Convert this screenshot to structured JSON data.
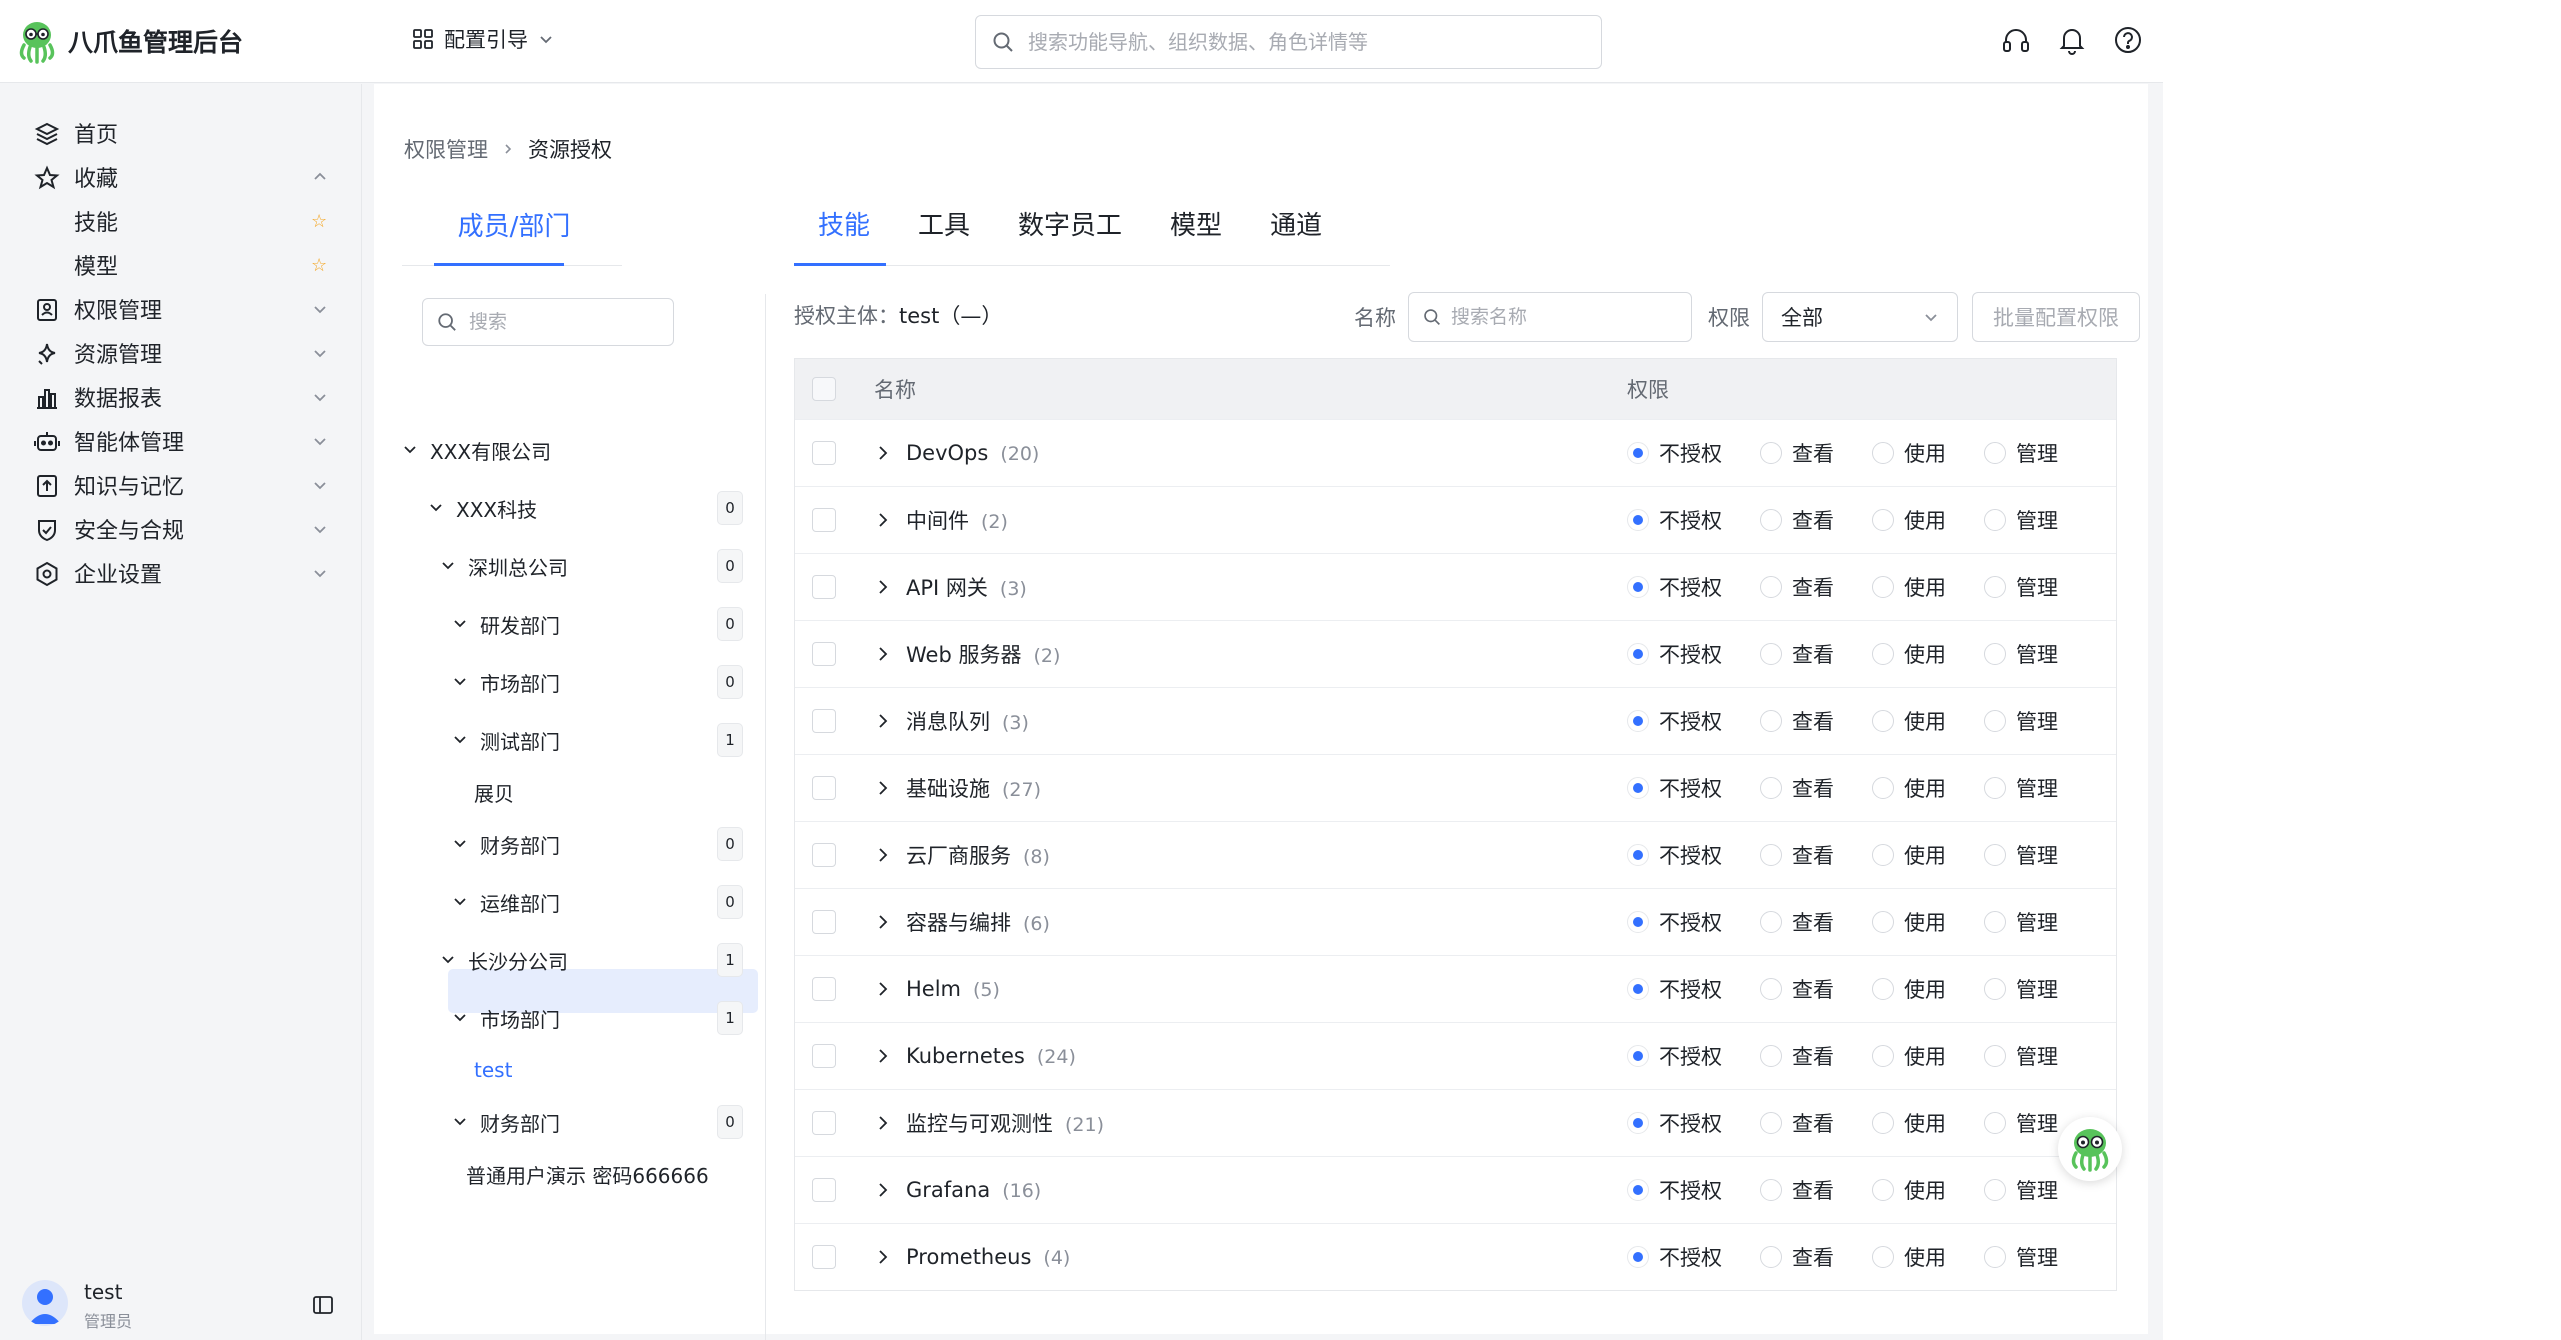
{
  "app": {
    "brand": "八爪鱼管理后台",
    "guide_label": "配置引导",
    "search_placeholder": "搜索功能导航、组织数据、角色详情等"
  },
  "sidebar": {
    "items": [
      {
        "label": "首页",
        "icon": "layers-icon"
      },
      {
        "label": "收藏",
        "icon": "star-icon"
      },
      {
        "label": "技能",
        "icon": "star-filled-icon"
      },
      {
        "label": "模型",
        "icon": "star-filled-icon"
      },
      {
        "label": "权限管理",
        "icon": "id-card-icon"
      },
      {
        "label": "资源管理",
        "icon": "sparkle-icon"
      },
      {
        "label": "数据报表",
        "icon": "bar-chart-icon"
      },
      {
        "label": "智能体管理",
        "icon": "robot-icon"
      },
      {
        "label": "知识与记忆",
        "icon": "book-upload-icon"
      },
      {
        "label": "安全与合规",
        "icon": "shield-check-icon"
      },
      {
        "label": "企业设置",
        "icon": "settings-hex-icon"
      }
    ],
    "user": {
      "name": "test",
      "role": "管理员"
    }
  },
  "breadcrumb": {
    "parent": "权限管理",
    "current": "资源授权"
  },
  "left_tab": "成员/部门",
  "tree": {
    "search_placeholder": "搜索",
    "nodes": [
      {
        "label": "XXX有限公司",
        "count": null
      },
      {
        "label": "XXX科技",
        "count": "0"
      },
      {
        "label": "深圳总公司",
        "count": "0"
      },
      {
        "label": "研发部门",
        "count": "0"
      },
      {
        "label": "市场部门",
        "count": "0"
      },
      {
        "label": "测试部门",
        "count": "1"
      },
      {
        "label": "展贝",
        "count": null
      },
      {
        "label": "财务部门",
        "count": "0"
      },
      {
        "label": "运维部门",
        "count": "0"
      },
      {
        "label": "长沙分公司",
        "count": "1"
      },
      {
        "label": "市场部门",
        "count": "1"
      },
      {
        "label": "test",
        "count": null
      },
      {
        "label": "财务部门",
        "count": "0"
      },
      {
        "label": "普通用户演示 密码666666",
        "count": null
      }
    ]
  },
  "tabs": [
    "技能",
    "工具",
    "数字员工",
    "模型",
    "通道"
  ],
  "subject": {
    "label": "授权主体：",
    "value": "test（—）"
  },
  "filters": {
    "name_label": "名称",
    "name_placeholder": "搜索名称",
    "perm_label": "权限",
    "perm_value": "全部",
    "batch_button": "批量配置权限"
  },
  "table": {
    "col_name": "名称",
    "col_perm": "权限",
    "perm_options": [
      "不授权",
      "查看",
      "使用",
      "管理"
    ],
    "rows": [
      {
        "name": "DevOps",
        "count": "(20)",
        "selected": "不授权"
      },
      {
        "name": "中间件",
        "count": "(2)",
        "selected": "不授权"
      },
      {
        "name": "API 网关",
        "count": "(3)",
        "selected": "不授权"
      },
      {
        "name": "Web 服务器",
        "count": "(2)",
        "selected": "不授权"
      },
      {
        "name": "消息队列",
        "count": "(3)",
        "selected": "不授权"
      },
      {
        "name": "基础设施",
        "count": "(27)",
        "selected": "不授权"
      },
      {
        "name": "云厂商服务",
        "count": "(8)",
        "selected": "不授权"
      },
      {
        "name": "容器与编排",
        "count": "(6)",
        "selected": "不授权"
      },
      {
        "name": "Helm",
        "count": "(5)",
        "selected": "不授权"
      },
      {
        "name": "Kubernetes",
        "count": "(24)",
        "selected": "不授权"
      },
      {
        "name": "监控与可观测性",
        "count": "(21)",
        "selected": "不授权"
      },
      {
        "name": "Grafana",
        "count": "(16)",
        "selected": "不授权"
      },
      {
        "name": "Prometheus",
        "count": "(4)",
        "selected": "不授权"
      }
    ]
  },
  "colors": {
    "accent": "#3370ff",
    "star": "#f5a623",
    "selected_bg": "#e6edfd"
  }
}
